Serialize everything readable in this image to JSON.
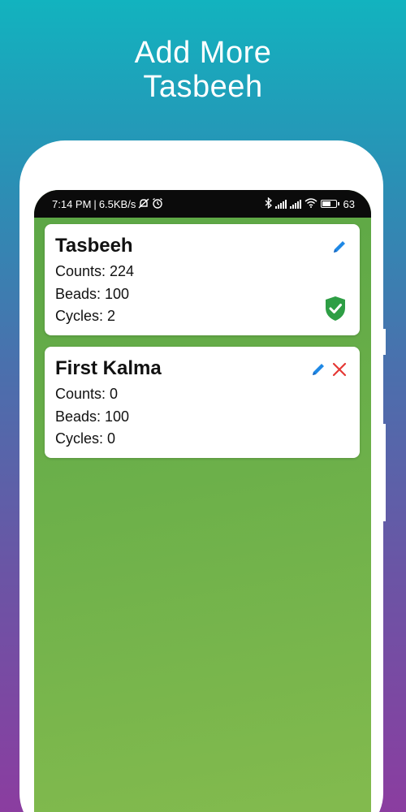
{
  "headline": {
    "line1": "Add More",
    "line2": "Tasbeeh"
  },
  "statusbar": {
    "time": "7:14 PM",
    "separator": "|",
    "speed": "6.5KB/s",
    "battery": "63"
  },
  "cards": [
    {
      "title": "Tasbeeh",
      "counts": "Counts: 224",
      "beads": "Beads: 100",
      "cycles": "Cycles: 2",
      "selected": true
    },
    {
      "title": "First Kalma",
      "counts": "Counts: 0",
      "beads": "Beads: 100",
      "cycles": "Cycles: 0",
      "selected": false
    }
  ],
  "icons": {
    "edit": "pencil-icon",
    "delete": "close-icon",
    "selected": "shield-check-icon"
  },
  "colors": {
    "accent_blue": "#1e88e5",
    "delete_red": "#e53935",
    "check_green": "#2e9e45",
    "screen_green": "#6cb04a"
  }
}
